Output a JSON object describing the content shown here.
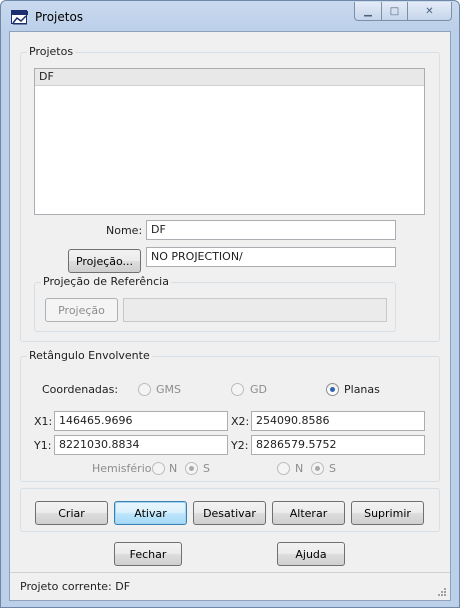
{
  "window": {
    "title": "Projetos",
    "minimize_glyph": "▁",
    "maximize_glyph": "□",
    "close_glyph": "✕"
  },
  "projects_group": {
    "title": "Projetos",
    "list_items": [
      "DF"
    ],
    "name_label": "Nome:",
    "name_value": "DF",
    "projection_button": "Projeção...",
    "projection_value": "NO PROJECTION/",
    "reference_group": {
      "title": "Projeção de Referência",
      "projection_button": "Projeção",
      "projection_value": ""
    }
  },
  "bounding_group": {
    "title": "Retângulo Envolvente",
    "coordinates_label": "Coordenadas:",
    "options": [
      {
        "label": "GMS",
        "selected": false,
        "enabled": false
      },
      {
        "label": "GD",
        "selected": false,
        "enabled": false
      },
      {
        "label": "Planas",
        "selected": true,
        "enabled": true
      }
    ],
    "x1_label": "X1:",
    "x1_value": "146465.9696",
    "x2_label": "X2:",
    "x2_value": "254090.8586",
    "y1_label": "Y1:",
    "y1_value": "8221030.8834",
    "y2_label": "Y2:",
    "y2_value": "8286579.5752",
    "hemisphere_label": "Hemisfério:",
    "hemisphere_1": {
      "n_label": "N",
      "s_label": "S",
      "selected": "S"
    },
    "hemisphere_2": {
      "n_label": "N",
      "s_label": "S",
      "selected": "S"
    }
  },
  "actions": {
    "create": "Criar",
    "activate": "Ativar",
    "deactivate": "Desativar",
    "modify": "Alterar",
    "delete": "Suprimir"
  },
  "footer_buttons": {
    "close": "Fechar",
    "help": "Ajuda"
  },
  "status_bar": {
    "text": "Projeto corrente: DF"
  },
  "colors": {
    "accent_radio": "#2d66b0",
    "active_button_border": "#3c7fb1",
    "frame": "#bcd0ea"
  }
}
